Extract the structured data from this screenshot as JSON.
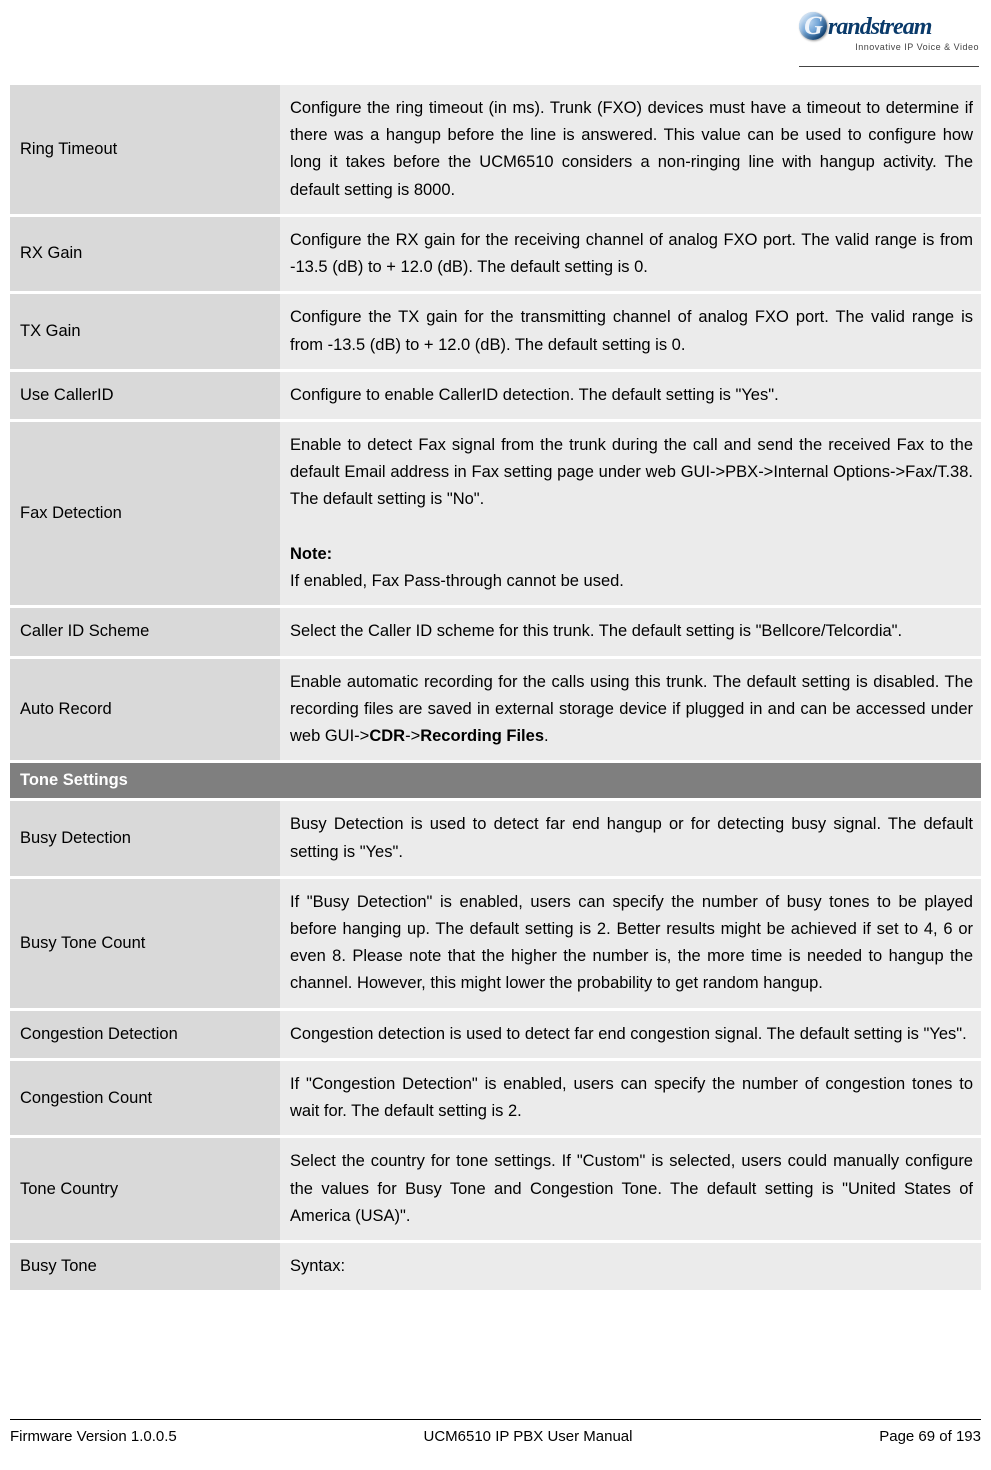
{
  "logo": {
    "text": "randstream",
    "tagline": "Innovative IP Voice & Video"
  },
  "rows_group1": [
    {
      "label": "Ring Timeout",
      "desc": "Configure the ring timeout (in ms). Trunk (FXO) devices must have a timeout to determine if there was a hangup before the line is answered. This value can be used to configure how long it takes before the UCM6510 considers a non-ringing line with hangup activity. The default setting is 8000."
    },
    {
      "label": "RX Gain",
      "desc": "Configure the RX gain for the receiving channel of analog FXO port. The valid range is from -13.5 (dB) to + 12.0 (dB). The default setting is 0."
    },
    {
      "label": "TX Gain",
      "desc": "Configure the TX gain for the transmitting channel of analog FXO port. The valid range is from -13.5 (dB) to + 12.0 (dB). The default setting is 0."
    },
    {
      "label": "Use CallerID",
      "desc": "Configure to enable CallerID detection. The default setting is \"Yes\"."
    },
    {
      "label": "Fax Detection",
      "desc": "Enable to detect Fax signal from the trunk during the call and send the received Fax to the default Email address in Fax setting page under web GUI->PBX->Internal Options->Fax/T.38. The default setting is \"No\".",
      "note_label": "Note:",
      "note_body": "If enabled, Fax Pass-through cannot be used."
    },
    {
      "label": "Caller ID Scheme",
      "desc": "Select the Caller ID scheme for this trunk. The default setting is \"Bellcore/Telcordia\"."
    },
    {
      "label": "Auto Record",
      "desc_pre": "Enable automatic recording for the calls using this trunk. The default setting is disabled. The recording files are saved in external storage device if plugged in and can be accessed under web GUI->",
      "bold1": "CDR",
      "mid": "->",
      "bold2": "Recording Files",
      "post": "."
    }
  ],
  "section_header": "Tone Settings",
  "rows_group2": [
    {
      "label": "Busy Detection",
      "desc": "Busy Detection is used to detect far end hangup or for detecting busy signal. The default setting is \"Yes\"."
    },
    {
      "label": "Busy Tone Count",
      "desc": "If \"Busy Detection\" is enabled, users can specify the number of busy tones to be played before hanging up. The default setting is 2. Better results might be achieved if set to 4, 6 or even 8. Please note that the higher the number is, the more time is needed to hangup the channel. However, this might lower the probability to get random hangup."
    },
    {
      "label": "Congestion Detection",
      "desc": "Congestion detection is used to detect far end congestion signal. The default setting is \"Yes\"."
    },
    {
      "label": "Congestion Count",
      "desc": "If \"Congestion Detection\" is enabled, users can specify the number of congestion tones to wait for. The default setting is 2."
    },
    {
      "label": "Tone Country",
      "desc": "Select the country for tone settings. If \"Custom\" is selected, users could manually configure the values for Busy Tone and Congestion Tone. The default setting is \"United States of America (USA)\"."
    },
    {
      "label": "Busy Tone",
      "desc": "Syntax:"
    }
  ],
  "footer": {
    "left": "Firmware Version 1.0.0.5",
    "center": "UCM6510 IP PBX User Manual",
    "right": "Page 69 of 193"
  }
}
